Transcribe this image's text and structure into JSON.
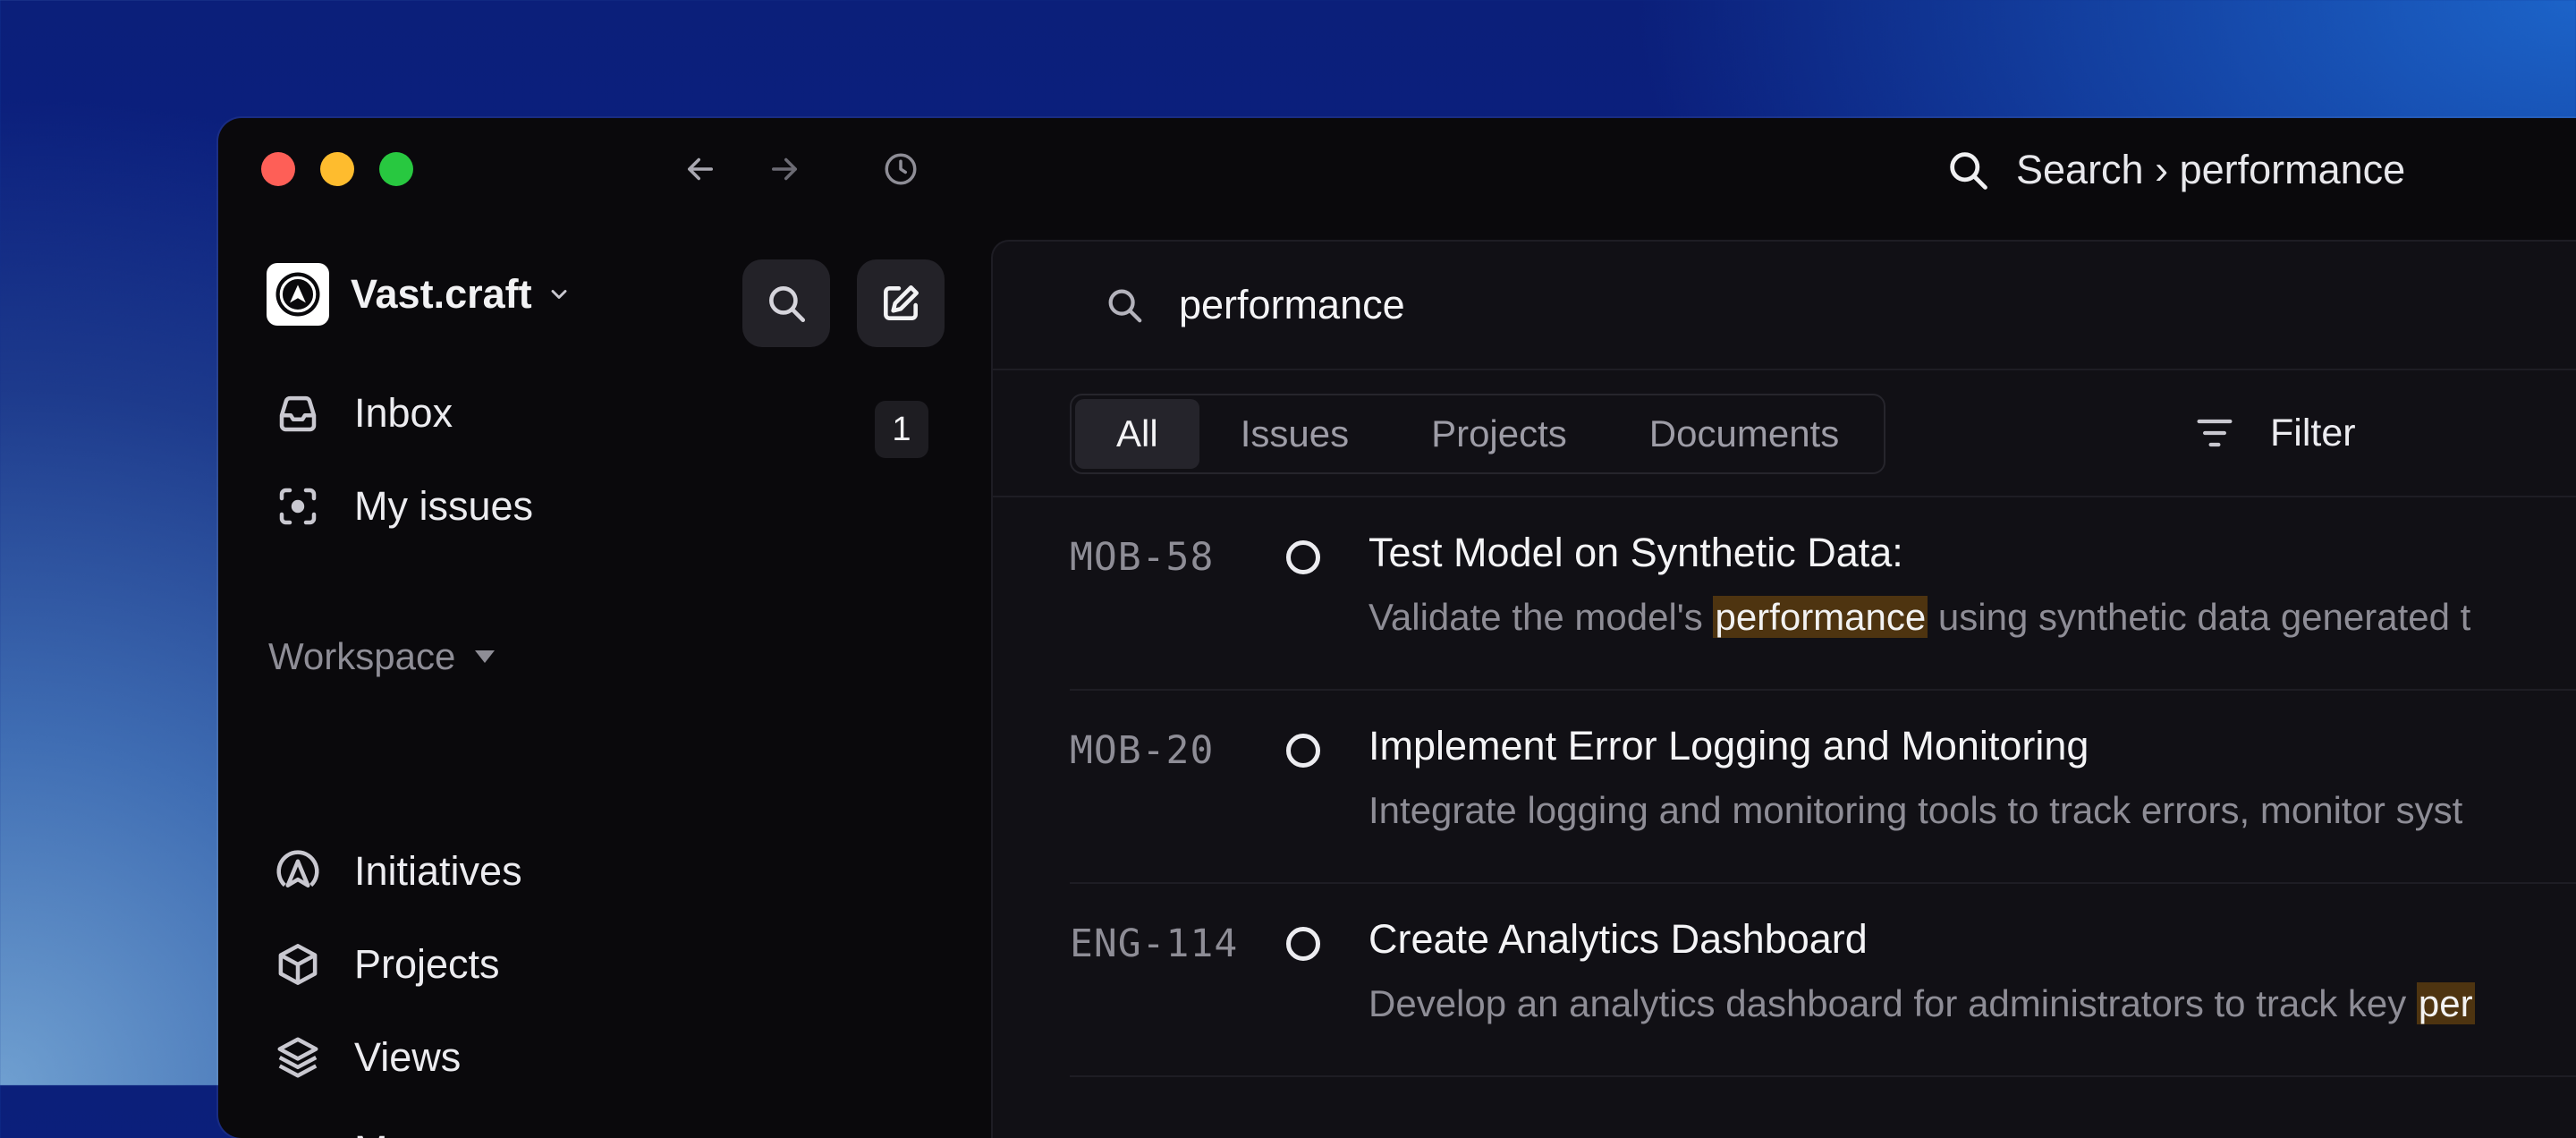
{
  "titlebar": {
    "search_breadcrumb": "Search › performance"
  },
  "sidebar": {
    "workspace_name": "Vast.craft",
    "items": [
      {
        "label": "Inbox",
        "icon": "inbox-icon",
        "badge": "1"
      },
      {
        "label": "My issues",
        "icon": "focus-icon"
      }
    ],
    "workspace_section": {
      "label": "Workspace",
      "items": [
        {
          "label": "Initiatives",
          "icon": "initiatives-icon"
        },
        {
          "label": "Projects",
          "icon": "box-icon"
        },
        {
          "label": "Views",
          "icon": "layers-icon"
        },
        {
          "label": "More",
          "icon": "more-icon"
        }
      ]
    }
  },
  "main": {
    "search_value": "performance",
    "tabs": [
      {
        "label": "All",
        "active": true
      },
      {
        "label": "Issues"
      },
      {
        "label": "Projects"
      },
      {
        "label": "Documents"
      }
    ],
    "filter_label": "Filter",
    "results": [
      {
        "id": "MOB-58",
        "title": "Test Model on Synthetic Data:",
        "desc_before": "Validate the model's ",
        "desc_match": "performance",
        "desc_after": " using synthetic data generated t"
      },
      {
        "id": "MOB-20",
        "title": "Implement Error Logging and Monitoring",
        "desc_before": "Integrate logging and monitoring tools to track errors, monitor syst",
        "desc_match": "",
        "desc_after": ""
      },
      {
        "id": "ENG-114",
        "title": "Create Analytics Dashboard",
        "desc_before": "Develop an analytics dashboard for administrators to track key ",
        "desc_match": "per",
        "desc_after": ""
      }
    ]
  },
  "colors": {
    "window_bg": "#0a090c",
    "panel_bg": "#111015",
    "highlight_bg": "#4e3410",
    "muted_text": "#8e8d96"
  }
}
